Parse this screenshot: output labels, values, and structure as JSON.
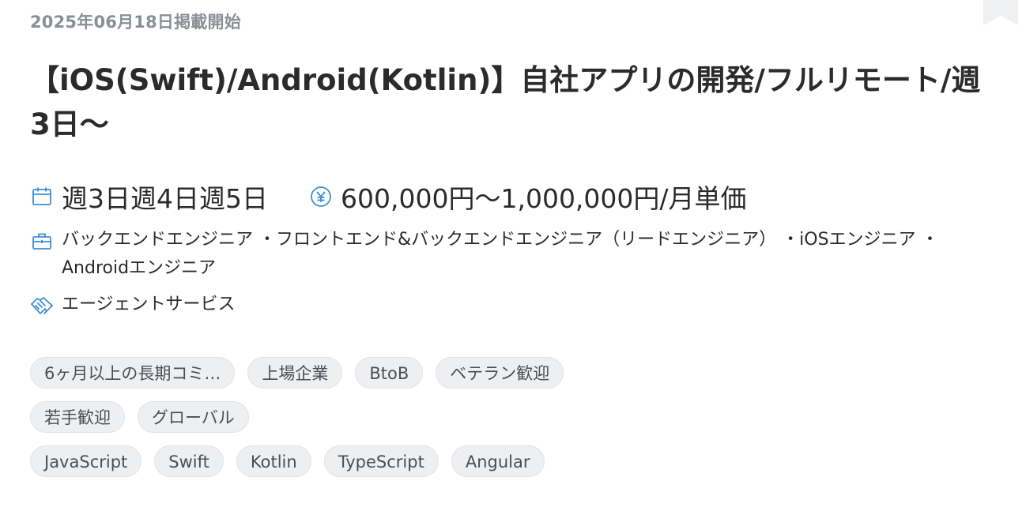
{
  "job": {
    "posted_date": "2025年06月18日掲載開始",
    "title": "【iOS(Swift)/Android(Kotlin)】自社アプリの開発/フルリモート/週3日〜",
    "work_days": "週3日週4日週5日",
    "salary": "600,000円〜1,000,000円/月単価",
    "roles": "バックエンドエンジニア ・フロントエンド&バックエンドエンジニア（リードエンジニア） ・iOSエンジニア ・Androidエンジニア",
    "service_type": "エージェントサービス"
  },
  "icons": {
    "bookmark": "bookmark-icon",
    "calendar": "calendar-icon",
    "yen": "yen-icon",
    "briefcase": "briefcase-icon",
    "handshake": "handshake-icon"
  },
  "tags": {
    "row1": [
      "6ヶ月以上の長期コミ…",
      "上場企業",
      "BtoB",
      "ベテラン歓迎"
    ],
    "row2": [
      "若手歓迎",
      "グローバル"
    ],
    "row3": [
      "JavaScript",
      "Swift",
      "Kotlin",
      "TypeScript",
      "Angular"
    ]
  },
  "colors": {
    "accent": "#3b8fd4",
    "muted_text": "#8a8f96",
    "tag_bg": "#eeeff1"
  }
}
